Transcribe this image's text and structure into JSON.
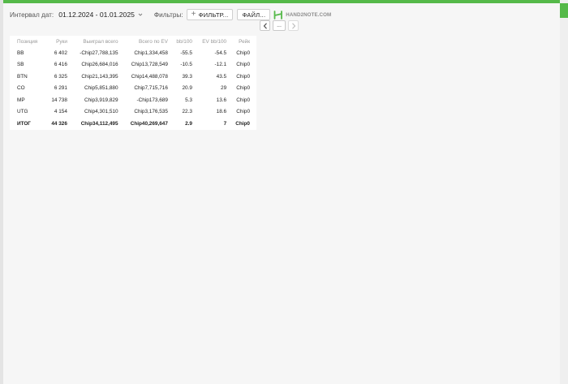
{
  "toolbar": {
    "date_label": "Интервал дат:",
    "date_range": "01.12.2024 - 01.01.2025",
    "filters_label": "Фильтры:",
    "filter_button": "ФИЛЬТР...",
    "file_button": "ФАЙЛ...",
    "logo_text": "HAND2NOTE.COM"
  },
  "pagination": {
    "ellipsis": "..."
  },
  "table": {
    "headers": [
      "Позиция",
      "Руки",
      "Выиграл всего",
      "Всего по EV",
      "bb/100",
      "EV bb/100",
      "Рейк"
    ],
    "rows": [
      {
        "position": "BB",
        "hands": "6 402",
        "won": "-Chip27,788,135",
        "won_color": "neg",
        "ev": "Chip1,334,458",
        "ev_color": "pos",
        "bb100": "-55.5",
        "bb100_color": "neg",
        "evbb": "-54.5",
        "evbb_color": "neg",
        "rake": "Chip0"
      },
      {
        "position": "SB",
        "hands": "6 416",
        "won": "Chip26,684,016",
        "won_color": "pos",
        "ev": "Chip13,728,549",
        "ev_color": "pos",
        "bb100": "-10.5",
        "bb100_color": "neg",
        "evbb": "-12.1",
        "evbb_color": "neg",
        "rake": "Chip0"
      },
      {
        "position": "BTN",
        "hands": "6 325",
        "won": "Chip21,143,395",
        "won_color": "pos",
        "ev": "Chip14,488,078",
        "ev_color": "pos",
        "bb100": "39.3",
        "bb100_color": "pos",
        "evbb": "43.5",
        "evbb_color": "pos",
        "rake": "Chip0"
      },
      {
        "position": "CO",
        "hands": "6 291",
        "won": "Chip5,851,880",
        "won_color": "pos",
        "ev": "Chip7,715,716",
        "ev_color": "pos",
        "bb100": "20.9",
        "bb100_color": "pos",
        "evbb": "29",
        "evbb_color": "pos",
        "rake": "Chip0"
      },
      {
        "position": "MP",
        "hands": "14 738",
        "won": "Chip3,919,829",
        "won_color": "pos",
        "ev": "-Chip173,689",
        "ev_color": "neg",
        "bb100": "5.3",
        "bb100_color": "pos",
        "evbb": "13.6",
        "evbb_color": "pos",
        "rake": "Chip0"
      },
      {
        "position": "UTG",
        "hands": "4 154",
        "won": "Chip4,301,510",
        "won_color": "pos",
        "ev": "Chip3,176,535",
        "ev_color": "pos",
        "bb100": "22.3",
        "bb100_color": "pos",
        "evbb": "18.6",
        "evbb_color": "pos",
        "rake": "Chip0"
      }
    ],
    "total": {
      "position": "ИТОГ",
      "hands": "44 326",
      "won": "Chip34,112,495",
      "ev": "Chip40,269,647",
      "bb100": "2.9",
      "evbb": "7",
      "rake": "Chip0"
    }
  },
  "colors": {
    "accent_green": "#55b949",
    "positive": "#4bab3d",
    "negative": "#d8362a"
  },
  "icons": {
    "add": "plus-icon",
    "logo": "hand2note-logo-icon",
    "dropdown": "chevron-down-icon",
    "prev": "chevron-left-icon",
    "next": "chevron-right-icon"
  }
}
